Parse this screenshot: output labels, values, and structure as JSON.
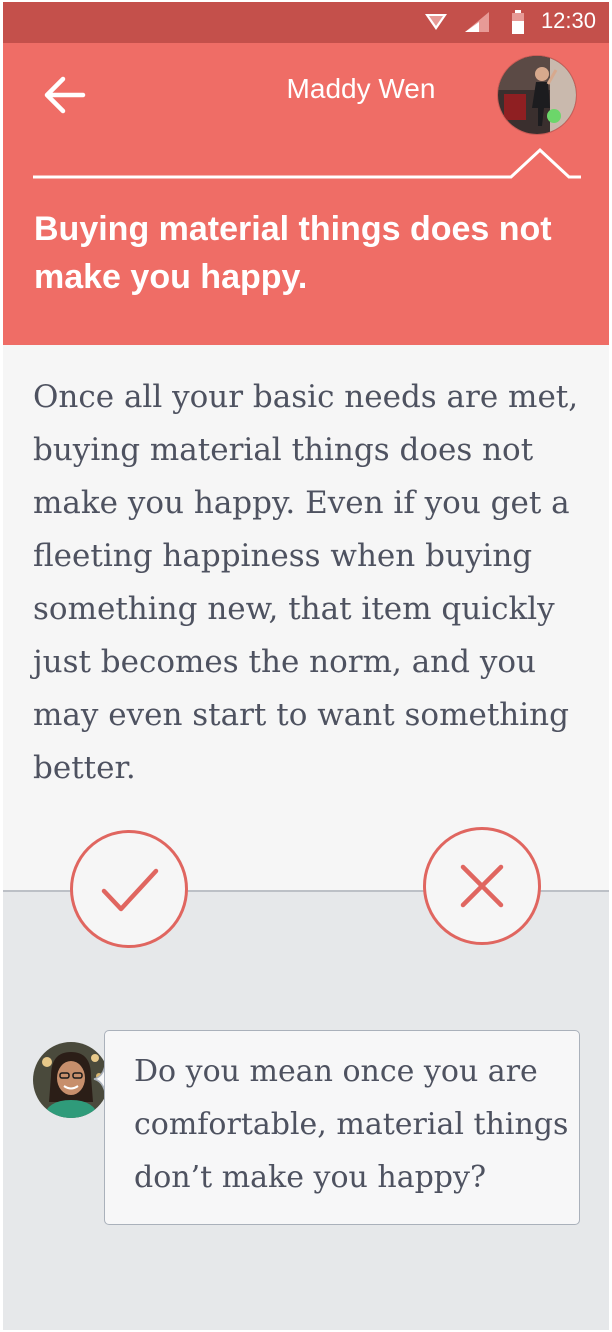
{
  "status_bar": {
    "time": "12:30",
    "icons": [
      "wifi-icon",
      "signal-icon",
      "battery-icon"
    ]
  },
  "header": {
    "back_icon": "arrow-left-icon",
    "contact_name": "Maddy Wen",
    "contact_status": "online",
    "title": "Buying material things does not make you happy."
  },
  "card": {
    "body": "Once all your basic needs are met, buying material things does not make you happy. Even if you get a fleeting happiness when buying something new, that item quickly just becomes the norm, and you may even start to want something better."
  },
  "actions": {
    "agree_icon": "checkmark-icon",
    "disagree_icon": "x-icon"
  },
  "reply": {
    "text": "Do you mean once you are comfortable, material things don’t make you happy?"
  },
  "colors": {
    "status_bar": "#c4504b",
    "header": "#ef6d66",
    "accent": "#e06660",
    "card_bg": "#f6f6f6",
    "page_bg": "#e6e8ea",
    "body_text": "#4e5260",
    "online": "#6cd66a"
  }
}
